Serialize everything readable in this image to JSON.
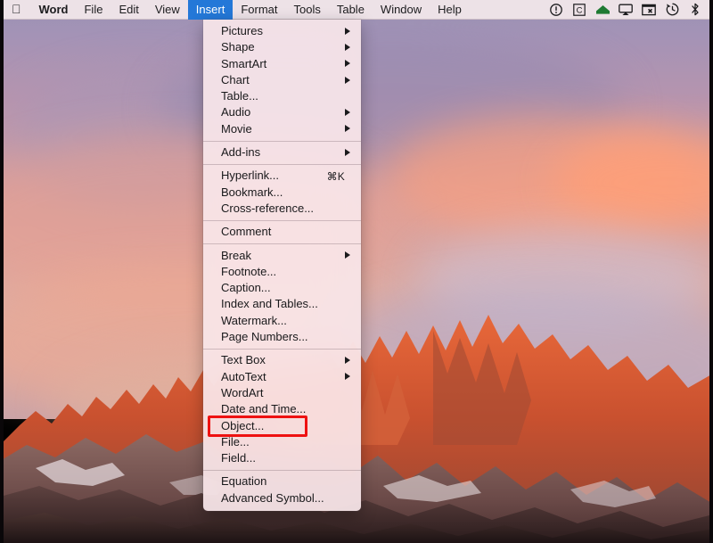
{
  "menubar": {
    "apple_logo": "",
    "app_name": "Word",
    "items": [
      {
        "label": "Word",
        "bold": true,
        "active": false
      },
      {
        "label": "File",
        "bold": false,
        "active": false
      },
      {
        "label": "Edit",
        "bold": false,
        "active": false
      },
      {
        "label": "View",
        "bold": false,
        "active": false
      },
      {
        "label": "Insert",
        "bold": false,
        "active": true
      },
      {
        "label": "Format",
        "bold": false,
        "active": false
      },
      {
        "label": "Tools",
        "bold": false,
        "active": false
      },
      {
        "label": "Table",
        "bold": false,
        "active": false
      },
      {
        "label": "Window",
        "bold": false,
        "active": false
      },
      {
        "label": "Help",
        "bold": false,
        "active": false
      }
    ],
    "status_icons": [
      "info-circle-icon",
      "letter-c-icon",
      "green-house-icon",
      "airplay-icon",
      "screen-capture-icon",
      "time-machine-icon",
      "bluetooth-icon"
    ]
  },
  "insert_menu": {
    "title": "Insert",
    "highlight_color": "#2478d8",
    "annotation_color": "#ee1111",
    "annotated_item": "Object...",
    "groups": [
      {
        "items": [
          {
            "label": "Pictures",
            "submenu": true,
            "shortcut": ""
          },
          {
            "label": "Shape",
            "submenu": true,
            "shortcut": ""
          },
          {
            "label": "SmartArt",
            "submenu": true,
            "shortcut": ""
          },
          {
            "label": "Chart",
            "submenu": true,
            "shortcut": ""
          },
          {
            "label": "Table...",
            "submenu": false,
            "shortcut": ""
          },
          {
            "label": "Audio",
            "submenu": true,
            "shortcut": ""
          },
          {
            "label": "Movie",
            "submenu": true,
            "shortcut": ""
          }
        ]
      },
      {
        "items": [
          {
            "label": "Add-ins",
            "submenu": true,
            "shortcut": ""
          }
        ]
      },
      {
        "items": [
          {
            "label": "Hyperlink...",
            "submenu": false,
            "shortcut": "⌘K"
          },
          {
            "label": "Bookmark...",
            "submenu": false,
            "shortcut": ""
          },
          {
            "label": "Cross-reference...",
            "submenu": false,
            "shortcut": ""
          }
        ]
      },
      {
        "items": [
          {
            "label": "Comment",
            "submenu": false,
            "shortcut": ""
          }
        ]
      },
      {
        "items": [
          {
            "label": "Break",
            "submenu": true,
            "shortcut": ""
          },
          {
            "label": "Footnote...",
            "submenu": false,
            "shortcut": ""
          },
          {
            "label": "Caption...",
            "submenu": false,
            "shortcut": ""
          },
          {
            "label": "Index and Tables...",
            "submenu": false,
            "shortcut": ""
          },
          {
            "label": "Watermark...",
            "submenu": false,
            "shortcut": ""
          },
          {
            "label": "Page Numbers...",
            "submenu": false,
            "shortcut": ""
          }
        ]
      },
      {
        "items": [
          {
            "label": "Text Box",
            "submenu": true,
            "shortcut": ""
          },
          {
            "label": "AutoText",
            "submenu": true,
            "shortcut": ""
          },
          {
            "label": "WordArt",
            "submenu": false,
            "shortcut": ""
          },
          {
            "label": "Date and Time...",
            "submenu": false,
            "shortcut": ""
          },
          {
            "label": "Object...",
            "submenu": false,
            "shortcut": ""
          },
          {
            "label": "File...",
            "submenu": false,
            "shortcut": ""
          },
          {
            "label": "Field...",
            "submenu": false,
            "shortcut": ""
          }
        ]
      },
      {
        "items": [
          {
            "label": "Equation",
            "submenu": false,
            "shortcut": ""
          },
          {
            "label": "Advanced Symbol...",
            "submenu": false,
            "shortcut": ""
          }
        ]
      }
    ]
  },
  "desktop": {
    "wallpaper_name": "macOS Sierra sunset mountains"
  }
}
